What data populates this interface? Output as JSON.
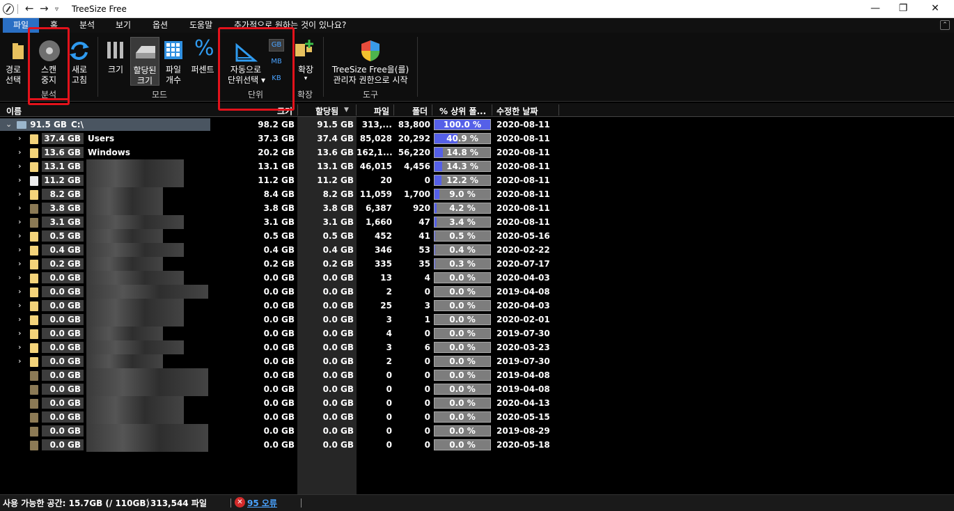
{
  "window": {
    "title": "TreeSize Free",
    "controls": {
      "minimize": "—",
      "restore": "❐",
      "close": "✕"
    }
  },
  "menu": [
    "파일",
    "홈",
    "분석",
    "보기",
    "옵션",
    "도움말",
    "추가적으로 원하는 것이 있나요?"
  ],
  "ribbon": {
    "scan_group": {
      "path_select_1": "경로",
      "path_select_2": "선택",
      "stop_1": "스캔",
      "stop_2": "중지",
      "refresh_1": "새로",
      "refresh_2": "고침",
      "label": "분석"
    },
    "mode_group": {
      "size": "크기",
      "allocated_1": "할당된",
      "allocated_2": "크기",
      "files_1": "파일",
      "files_2": "개수",
      "percent": "퍼센트",
      "label": "모드"
    },
    "unit_group": {
      "auto_1": "자동으로",
      "auto_2": "단위선택 ▾",
      "gb": "GB",
      "mb": "MB",
      "kb": "KB",
      "label": "단위"
    },
    "expand_group": {
      "expand": "확장",
      "arrow": "▾",
      "label": "확장"
    },
    "tools_group": {
      "admin_1": "TreeSize Free을(를)",
      "admin_2": "관리자 권한으로 시작",
      "label": "도구"
    }
  },
  "columns": {
    "name": "이름",
    "size": "크기",
    "allocated": "할당됨",
    "files": "파일",
    "folders": "폴더",
    "percent": "% 상위 폴...",
    "modified": "수정한 날짜"
  },
  "rows": [
    {
      "size_label": "91.5 GB",
      "name": "C:\\",
      "size": "98.2 GB",
      "alloc": "91.5 GB",
      "files": "313,...",
      "folders": "83,800",
      "pct": 100.0,
      "pct_text": "100.0 %",
      "date": "2020-08-11"
    },
    {
      "size_label": "37.4 GB",
      "name": "Users",
      "size": "37.3 GB",
      "alloc": "37.4 GB",
      "files": "85,028",
      "folders": "20,292",
      "pct": 40.9,
      "pct_text": "40.9 %",
      "date": "2020-08-11"
    },
    {
      "size_label": "13.6 GB",
      "name": "Windows",
      "size": "20.2 GB",
      "alloc": "13.6 GB",
      "files": "162,1...",
      "folders": "56,220",
      "pct": 14.8,
      "pct_text": "14.8 %",
      "date": "2020-08-11"
    },
    {
      "size_label": "13.1 GB",
      "name": "",
      "size": "13.1 GB",
      "alloc": "13.1 GB",
      "files": "46,015",
      "folders": "4,456",
      "pct": 14.3,
      "pct_text": "14.3 %",
      "date": "2020-08-11"
    },
    {
      "size_label": "11.2 GB",
      "name": "",
      "size": "11.2 GB",
      "alloc": "11.2 GB",
      "files": "20",
      "folders": "0",
      "pct": 12.2,
      "pct_text": "12.2 %",
      "date": "2020-08-11"
    },
    {
      "size_label": "8.2 GB",
      "name": "",
      "size": "8.4 GB",
      "alloc": "8.2 GB",
      "files": "11,059",
      "folders": "1,700",
      "pct": 9.0,
      "pct_text": "9.0 %",
      "date": "2020-08-11"
    },
    {
      "size_label": "3.8 GB",
      "name": "",
      "size": "3.8 GB",
      "alloc": "3.8 GB",
      "files": "6,387",
      "folders": "920",
      "pct": 4.2,
      "pct_text": "4.2 %",
      "date": "2020-08-11"
    },
    {
      "size_label": "3.1 GB",
      "name": "",
      "size": "3.1 GB",
      "alloc": "3.1 GB",
      "files": "1,660",
      "folders": "47",
      "pct": 3.4,
      "pct_text": "3.4 %",
      "date": "2020-08-11"
    },
    {
      "size_label": "0.5 GB",
      "name": "",
      "size": "0.5 GB",
      "alloc": "0.5 GB",
      "files": "452",
      "folders": "41",
      "pct": 0.5,
      "pct_text": "0.5 %",
      "date": "2020-05-16"
    },
    {
      "size_label": "0.4 GB",
      "name": "",
      "size": "0.4 GB",
      "alloc": "0.4 GB",
      "files": "346",
      "folders": "53",
      "pct": 0.4,
      "pct_text": "0.4 %",
      "date": "2020-02-22"
    },
    {
      "size_label": "0.2 GB",
      "name": "",
      "size": "0.2 GB",
      "alloc": "0.2 GB",
      "files": "335",
      "folders": "35",
      "pct": 0.3,
      "pct_text": "0.3 %",
      "date": "2020-07-17"
    },
    {
      "size_label": "0.0 GB",
      "name": "",
      "size": "0.0 GB",
      "alloc": "0.0 GB",
      "files": "13",
      "folders": "4",
      "pct": 0.0,
      "pct_text": "0.0 %",
      "date": "2020-04-03"
    },
    {
      "size_label": "0.0 GB",
      "name": "",
      "size": "0.0 GB",
      "alloc": "0.0 GB",
      "files": "2",
      "folders": "0",
      "pct": 0.0,
      "pct_text": "0.0 %",
      "date": "2019-04-08"
    },
    {
      "size_label": "0.0 GB",
      "name": "",
      "size": "0.0 GB",
      "alloc": "0.0 GB",
      "files": "25",
      "folders": "3",
      "pct": 0.0,
      "pct_text": "0.0 %",
      "date": "2020-04-03"
    },
    {
      "size_label": "0.0 GB",
      "name": "",
      "size": "0.0 GB",
      "alloc": "0.0 GB",
      "files": "3",
      "folders": "1",
      "pct": 0.0,
      "pct_text": "0.0 %",
      "date": "2020-02-01"
    },
    {
      "size_label": "0.0 GB",
      "name": "",
      "size": "0.0 GB",
      "alloc": "0.0 GB",
      "files": "4",
      "folders": "0",
      "pct": 0.0,
      "pct_text": "0.0 %",
      "date": "2019-07-30"
    },
    {
      "size_label": "0.0 GB",
      "name": "",
      "size": "0.0 GB",
      "alloc": "0.0 GB",
      "files": "3",
      "folders": "6",
      "pct": 0.0,
      "pct_text": "0.0 %",
      "date": "2020-03-23"
    },
    {
      "size_label": "0.0 GB",
      "name": "",
      "size": "0.0 GB",
      "alloc": "0.0 GB",
      "files": "2",
      "folders": "0",
      "pct": 0.0,
      "pct_text": "0.0 %",
      "date": "2019-07-30"
    },
    {
      "size_label": "0.0 GB",
      "name": "",
      "size": "0.0 GB",
      "alloc": "0.0 GB",
      "files": "0",
      "folders": "0",
      "pct": 0.0,
      "pct_text": "0.0 %",
      "date": "2019-04-08"
    },
    {
      "size_label": "0.0 GB",
      "name": "",
      "size": "0.0 GB",
      "alloc": "0.0 GB",
      "files": "0",
      "folders": "0",
      "pct": 0.0,
      "pct_text": "0.0 %",
      "date": "2019-04-08"
    },
    {
      "size_label": "0.0 GB",
      "name": "",
      "size": "0.0 GB",
      "alloc": "0.0 GB",
      "files": "0",
      "folders": "0",
      "pct": 0.0,
      "pct_text": "0.0 %",
      "date": "2020-04-13"
    },
    {
      "size_label": "0.0 GB",
      "name": "",
      "size": "0.0 GB",
      "alloc": "0.0 GB",
      "files": "0",
      "folders": "0",
      "pct": 0.0,
      "pct_text": "0.0 %",
      "date": "2020-05-15"
    },
    {
      "size_label": "0.0 GB",
      "name": "",
      "size": "0.0 GB",
      "alloc": "0.0 GB",
      "files": "0",
      "folders": "0",
      "pct": 0.0,
      "pct_text": "0.0 %",
      "date": "2019-08-29"
    },
    {
      "size_label": "0.0 GB",
      "name": "",
      "size": "0.0 GB",
      "alloc": "0.0 GB",
      "files": "0",
      "folders": "0",
      "pct": 0.0,
      "pct_text": "0.0 %",
      "date": "2020-05-18"
    }
  ],
  "status": {
    "free_space": "사용 가능한 공간: 15.7GB  (/ 110GB)",
    "file_count": "313,544 파일",
    "error_icon": "✕",
    "errors": "95 오류"
  },
  "colors": {
    "accent": "#2a6fc4",
    "highlight": "#e3121b",
    "pct_fill": "#5560e8"
  }
}
